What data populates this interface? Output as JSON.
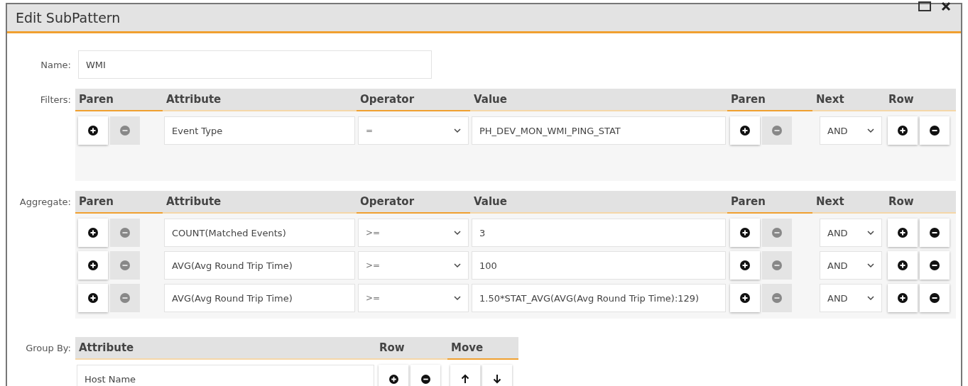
{
  "window": {
    "title": "Edit SubPattern"
  },
  "name": {
    "label": "Name:",
    "value": "WMI"
  },
  "filters": {
    "label": "Filters:",
    "columns": [
      "Paren",
      "Attribute",
      "Operator",
      "Value",
      "Paren",
      "Next",
      "Row"
    ],
    "rows": [
      {
        "attribute": "Event Type",
        "operator": "=",
        "value": "PH_DEV_MON_WMI_PING_STAT",
        "next": "AND",
        "left_paren_remove_disabled": true,
        "right_paren_remove_disabled": true
      }
    ]
  },
  "aggregate": {
    "label": "Aggregate:",
    "columns": [
      "Paren",
      "Attribute",
      "Operator",
      "Value",
      "Paren",
      "Next",
      "Row"
    ],
    "rows": [
      {
        "attribute": "COUNT(Matched Events)",
        "operator": ">=",
        "value": "3",
        "next": "AND",
        "left_paren_remove_disabled": true,
        "right_paren_remove_disabled": true
      },
      {
        "attribute": "AVG(Avg Round Trip Time)",
        "operator": ">=",
        "value": "100",
        "next": "AND",
        "left_paren_remove_disabled": true,
        "right_paren_remove_disabled": true
      },
      {
        "attribute": "AVG(Avg Round Trip Time)",
        "operator": ">=",
        "value": "1.50*STAT_AVG(AVG(Avg Round Trip Time):129)",
        "next": "AND",
        "left_paren_remove_disabled": true,
        "right_paren_remove_disabled": true
      }
    ]
  },
  "group_by": {
    "label": "Group By:",
    "columns": [
      "Attribute",
      "Row",
      "Move"
    ],
    "rows": [
      {
        "attribute": "Host Name"
      }
    ]
  }
}
